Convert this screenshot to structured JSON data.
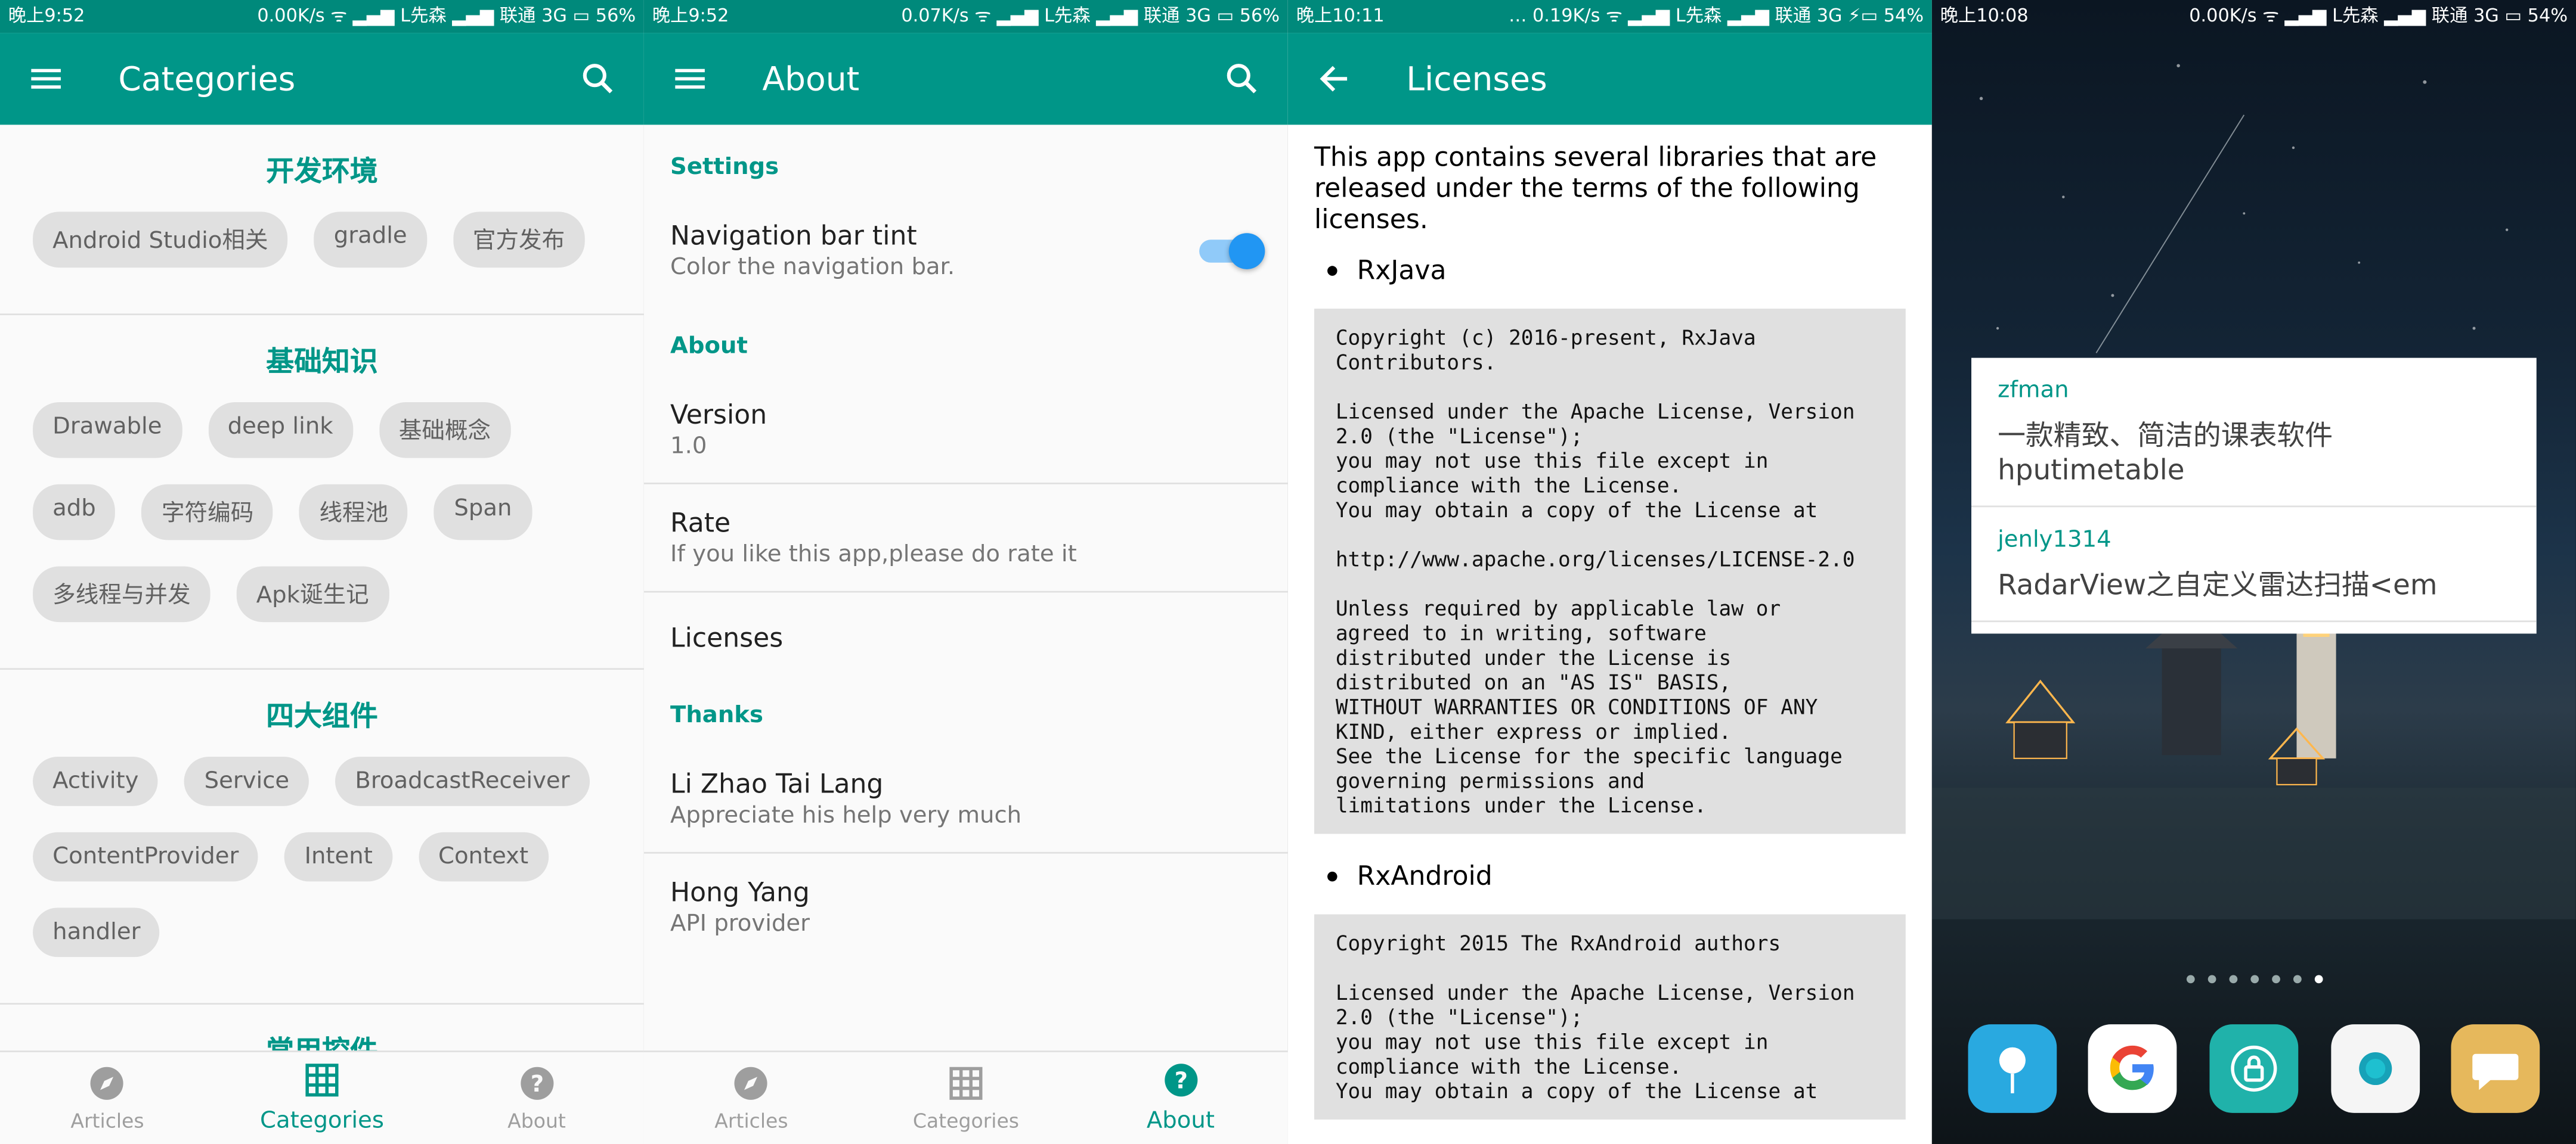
{
  "screens": [
    {
      "status": {
        "time": "晚上9:52",
        "right": "0.00K/s ᯤ ▂▄▆ L先森 ▂▄▆ 联通 3G ▭ 56%"
      },
      "toolbar": {
        "title": "Categories"
      },
      "groups": [
        {
          "title": "开发环境",
          "chips": [
            "Android Studio相关",
            "gradle",
            "官方发布"
          ]
        },
        {
          "title": "基础知识",
          "chips": [
            "Drawable",
            "deep link",
            "基础概念",
            "adb",
            "字符编码",
            "线程池",
            "Span",
            "多线程与并发",
            "Apk诞生记"
          ]
        },
        {
          "title": "四大组件",
          "chips": [
            "Activity",
            "Service",
            "BroadcastReceiver",
            "ContentProvider",
            "Intent",
            "Context",
            "handler"
          ]
        },
        {
          "title": "常用控件",
          "chips": []
        }
      ],
      "nav": [
        {
          "label": "Articles",
          "icon": "compass-icon",
          "active": false
        },
        {
          "label": "Categories",
          "icon": "grid-icon",
          "active": true
        },
        {
          "label": "About",
          "icon": "help-icon",
          "active": false
        }
      ]
    },
    {
      "status": {
        "time": "晚上9:52",
        "right": "0.07K/s ᯤ ▂▄▆ L先森 ▂▄▆ 联通 3G ▭ 56%"
      },
      "toolbar": {
        "title": "About"
      },
      "sections": {
        "settings": "Settings",
        "nav_tint_title": "Navigation bar tint",
        "nav_tint_sub": "Color the navigation bar.",
        "about": "About",
        "version_title": "Version",
        "version_value": "1.0",
        "rate_title": "Rate",
        "rate_sub": "If you like this app,please do rate it",
        "licenses": "Licenses",
        "thanks": "Thanks",
        "thanks1_title": "Li Zhao Tai Lang",
        "thanks1_sub": "Appreciate his help very much",
        "thanks2_title": "Hong Yang",
        "thanks2_sub": "API provider"
      },
      "nav": [
        {
          "label": "Articles",
          "icon": "compass-icon",
          "active": false
        },
        {
          "label": "Categories",
          "icon": "grid-icon",
          "active": false
        },
        {
          "label": "About",
          "icon": "help-icon",
          "active": true
        }
      ]
    },
    {
      "status": {
        "time": "晚上10:11",
        "right": "… 0.19K/s ᯤ ▂▄▆ L先森 ▂▄▆ 联通 3G ⚡▭ 54%"
      },
      "toolbar": {
        "title": "Licenses"
      },
      "intro": "This app contains several libraries that are released under the terms of the following licenses.",
      "libs": [
        {
          "name": "RxJava",
          "text": "Copyright (c) 2016-present, RxJava\nContributors.\n\nLicensed under the Apache License, Version\n2.0 (the \"License\");\nyou may not use this file except in\ncompliance with the License.\nYou may obtain a copy of the License at\n\nhttp://www.apache.org/licenses/LICENSE-2.0\n\nUnless required by applicable law or\nagreed to in writing, software\ndistributed under the License is\ndistributed on an \"AS IS\" BASIS,\nWITHOUT WARRANTIES OR CONDITIONS OF ANY\nKIND, either express or implied.\nSee the License for the specific language\ngoverning permissions and\nlimitations under the License."
        },
        {
          "name": "RxAndroid",
          "text": "Copyright 2015 The RxAndroid authors\n\nLicensed under the Apache License, Version\n2.0 (the \"License\");\nyou may not use this file except in\ncompliance with the License.\nYou may obtain a copy of the License at"
        }
      ]
    },
    {
      "status": {
        "time": "晚上10:08",
        "right": "0.00K/s ᯤ ▂▄▆ L先森 ▂▄▆ 联通 3G ▭ 54%"
      },
      "widget": [
        {
          "user": "zfman",
          "title": "一款精致、简洁的课表软件 hputimetable"
        },
        {
          "user": "jenly1314",
          "title": "RadarView之自定义雷达扫描<em"
        }
      ],
      "page_dots": 7,
      "page_active": 6,
      "dock": [
        {
          "icon": "messages-app-icon",
          "color": "#29a9e0"
        },
        {
          "icon": "google-app-icon",
          "color": "#ffffff"
        },
        {
          "icon": "security-app-icon",
          "color": "#20b2aa"
        },
        {
          "icon": "camera-app-icon",
          "color": "#f5f5f5"
        },
        {
          "icon": "chat-app-icon",
          "color": "#e6b85c"
        }
      ]
    }
  ]
}
